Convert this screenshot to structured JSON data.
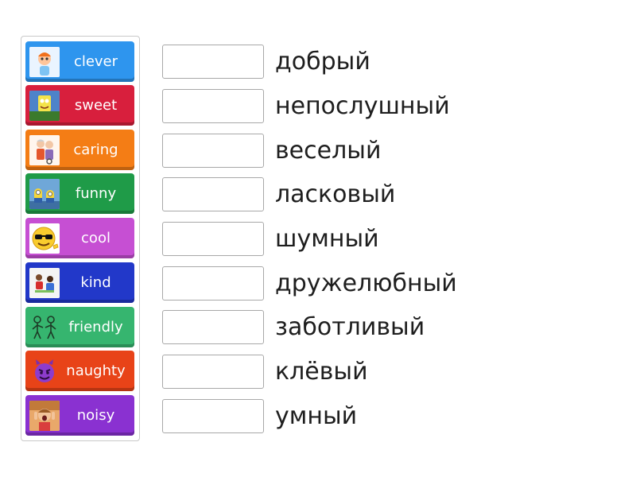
{
  "tiles": [
    {
      "label": "clever",
      "icon": "boy-cartoon-icon",
      "color": "#2e95ee"
    },
    {
      "label": "sweet",
      "icon": "sponge-cartoon-icon",
      "color": "#d81f3d"
    },
    {
      "label": "caring",
      "icon": "elderly-couple-icon",
      "color": "#f47d15"
    },
    {
      "label": "funny",
      "icon": "minions-icon",
      "color": "#1f9b48"
    },
    {
      "label": "cool",
      "icon": "sunglasses-emoji-icon",
      "color": "#c64fd3"
    },
    {
      "label": "kind",
      "icon": "children-helping-icon",
      "color": "#2238c9"
    },
    {
      "label": "friendly",
      "icon": "friends-sketch-icon",
      "color": "#36b56f"
    },
    {
      "label": "naughty",
      "icon": "devil-emoji-icon",
      "color": "#e84318"
    },
    {
      "label": "noisy",
      "icon": "shouting-boy-icon",
      "color": "#8a31d1"
    }
  ],
  "words": [
    "добрый",
    "непослушный",
    "веселый",
    "ласковый",
    "шумный",
    "дружелюбный",
    "заботливый",
    "клёвый",
    "умный"
  ]
}
